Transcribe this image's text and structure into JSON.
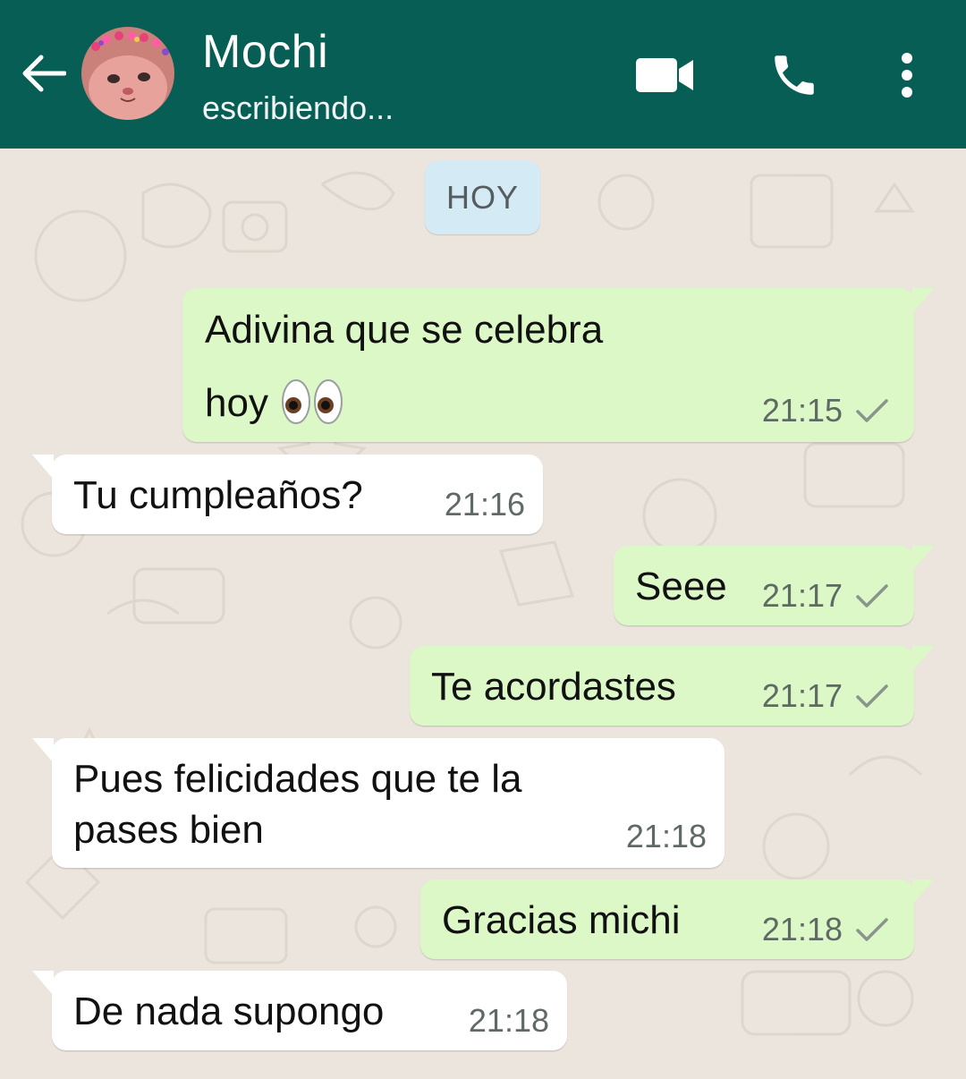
{
  "header": {
    "contact_name": "Mochi",
    "status": "escribiendo...",
    "back_icon": "arrow-left-icon",
    "video_icon": "videocam-icon",
    "call_icon": "phone-icon",
    "menu_icon": "more-vert-icon",
    "bg_color": "#075e54"
  },
  "chat": {
    "day_label": "HOY",
    "messages": [
      {
        "direction": "outgoing",
        "lines": [
          "Adivina que se celebra",
          "hoy"
        ],
        "emoji": "eyes",
        "time": "21:15",
        "status": "sent"
      },
      {
        "direction": "incoming",
        "text": "Tu cumpleaños?",
        "time": "21:16"
      },
      {
        "direction": "outgoing",
        "text": "Seee",
        "time": "21:17",
        "status": "sent"
      },
      {
        "direction": "outgoing",
        "text": "Te acordastes",
        "time": "21:17",
        "status": "sent"
      },
      {
        "direction": "incoming",
        "lines": [
          "Pues felicidades que te la",
          "pases bien"
        ],
        "time": "21:18"
      },
      {
        "direction": "outgoing",
        "text": "Gracias michi",
        "time": "21:18",
        "status": "sent"
      },
      {
        "direction": "incoming",
        "text": "De nada supongo",
        "time": "21:18"
      }
    ]
  },
  "colors": {
    "outgoing_bubble": "#dcf8c6",
    "incoming_bubble": "#ffffff",
    "wallpaper": "#ece5dd",
    "day_chip": "#d4eaf4"
  }
}
